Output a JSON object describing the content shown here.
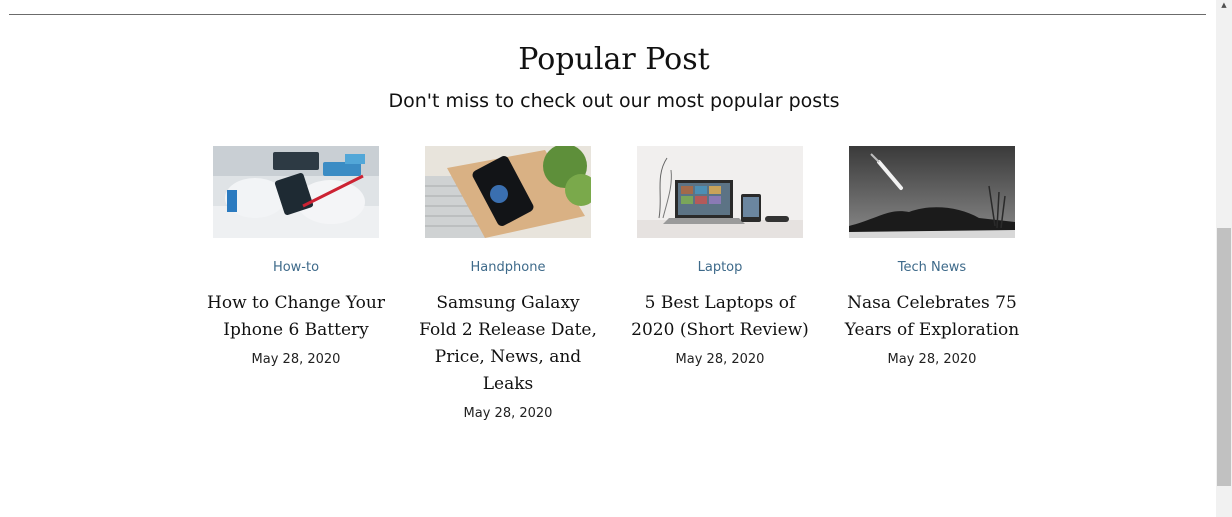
{
  "section": {
    "title": "Popular Post",
    "subtitle": "Don't miss to check out our most popular posts"
  },
  "posts": [
    {
      "category": "How-to",
      "title": "How to Change Your Iphone 6 Battery",
      "date": "May 28, 2020",
      "image": "phone-repair-photo"
    },
    {
      "category": "Handphone",
      "title": "Samsung Galaxy Fold 2 Release Date, Price, News, and Leaks",
      "date": "May 28, 2020",
      "image": "foldable-phone-photo"
    },
    {
      "category": "Laptop",
      "title": "5 Best Laptops of 2020 (Short Review)",
      "date": "May 28, 2020",
      "image": "laptop-desk-photo"
    },
    {
      "category": "Tech News",
      "title": "Nasa Celebrates 75 Years of Exploration",
      "date": "May 28, 2020",
      "image": "rocket-launch-photo"
    }
  ],
  "colors": {
    "category_link": "#3e6a8a",
    "divider": "#6b6b6b",
    "scrollbar_track": "#f1f1f1",
    "scrollbar_thumb": "#c1c1c1"
  }
}
